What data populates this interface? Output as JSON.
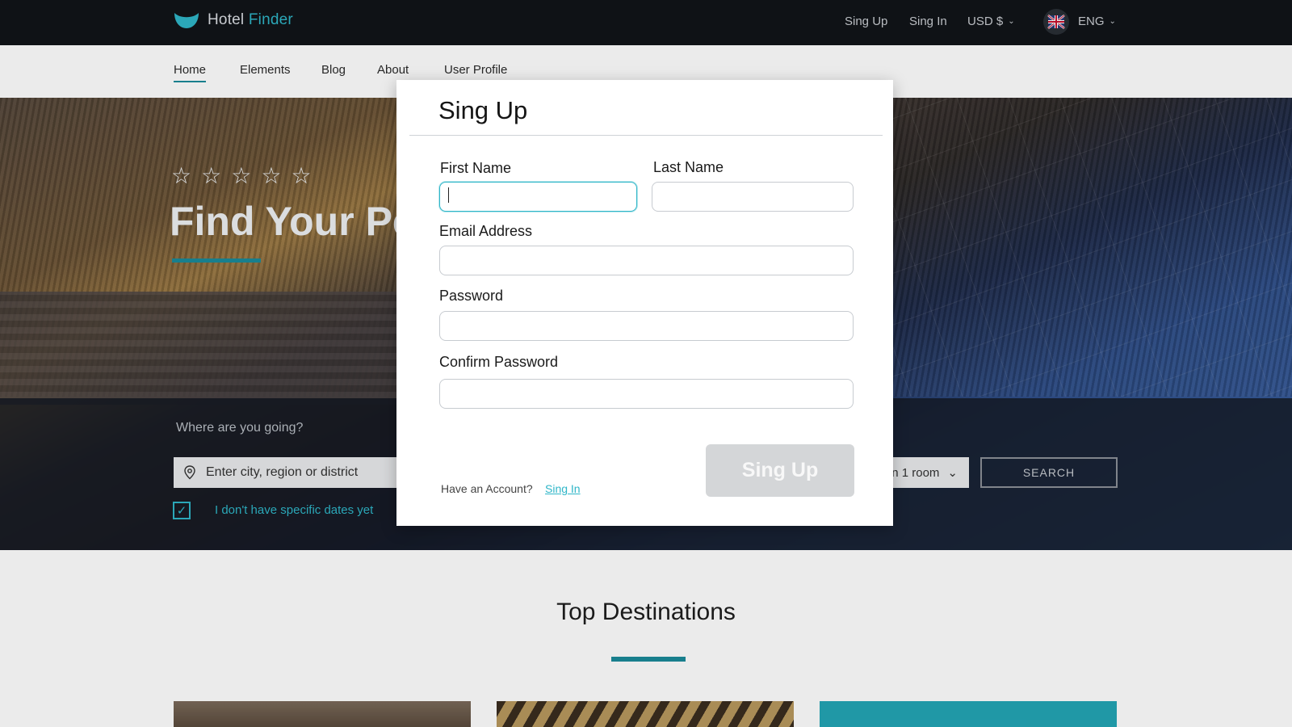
{
  "brand": {
    "name_part1": "Hotel",
    "name_part2": "Finder",
    "accent_color": "#2fb6c8"
  },
  "topbar": {
    "signup_label": "Sing Up",
    "signin_label": "Sing In",
    "currency_label": "USD  $",
    "language_label": "ENG",
    "flag_icon": "uk-flag-icon"
  },
  "nav": {
    "items": [
      {
        "label": "Home",
        "active": true
      },
      {
        "label": "Elements"
      },
      {
        "label": "Blog"
      },
      {
        "label": "About"
      },
      {
        "label": "User Profile"
      }
    ]
  },
  "hero": {
    "star_glyph": "☆",
    "star_count": 5,
    "title": "Find Your Pe",
    "where_label": "Where are you going?",
    "destination_placeholder": "Enter city, region or district",
    "room_label": "n 1 room",
    "search_label": "SEARCH",
    "no_dates_label": "I don't have specific dates yet"
  },
  "top_destinations": {
    "title": "Top Destinations"
  },
  "modal": {
    "title": "Sing Up",
    "first_name_label": "First Name",
    "last_name_label": "Last Name",
    "email_label": "Email Address",
    "password_label": "Password",
    "confirm_password_label": "Confirm Password",
    "first_name_value": "",
    "last_name_value": "",
    "email_value": "",
    "password_value": "",
    "confirm_password_value": "",
    "submit_label": "Sing Up",
    "have_account_text": "Have an Account?",
    "signin_link": "Sing In"
  }
}
